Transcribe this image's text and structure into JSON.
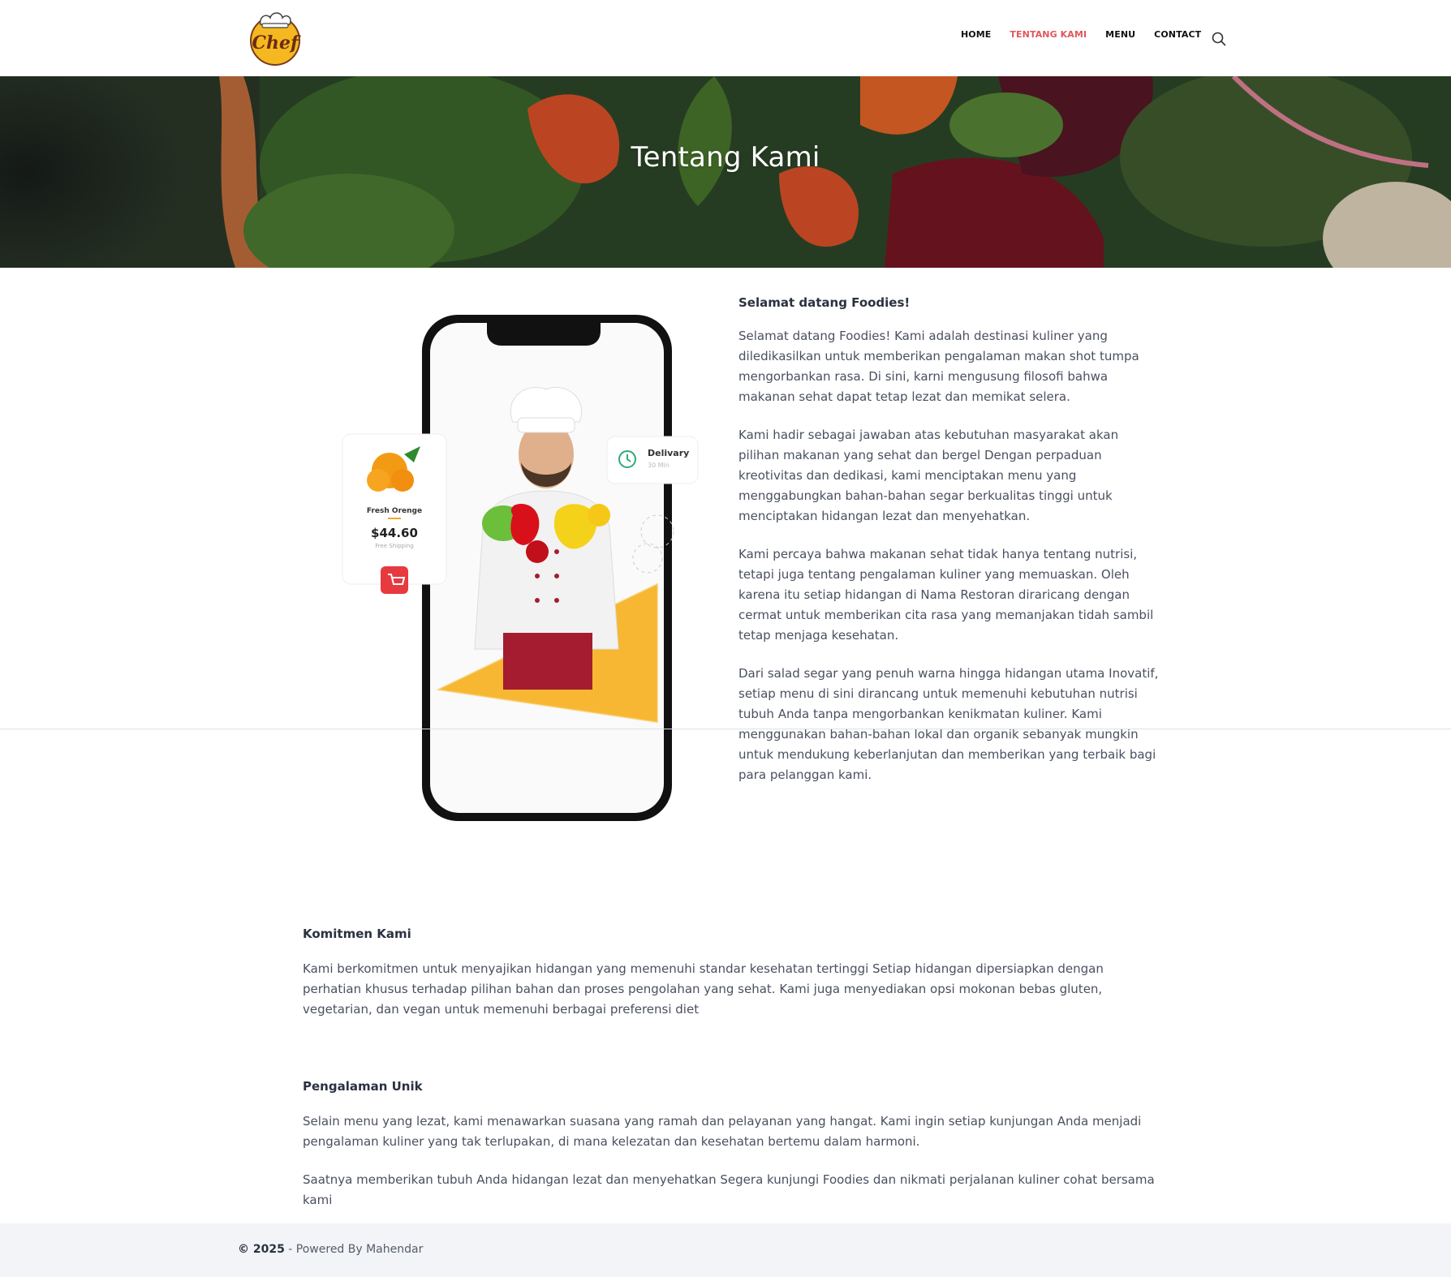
{
  "header": {
    "logo_text": "Chef",
    "nav": [
      {
        "label": "HOME",
        "active": false
      },
      {
        "label": "TENTANG KAMI",
        "active": true
      },
      {
        "label": "MENU",
        "active": false
      },
      {
        "label": "CONTACT",
        "active": false
      }
    ],
    "search_icon": "search-icon"
  },
  "hero": {
    "title": "Tentang Kami"
  },
  "illustration": {
    "product_name": "Fresh Orenge",
    "price": "$44.60",
    "shipping": "Free Shipping",
    "delivery_label": "Delivary",
    "delivery_time": "30 Min"
  },
  "about": {
    "heading": "Selamat datang Foodies!",
    "paragraphs": [
      "Selamat datang Foodies! Kami adalah destinasi kuliner yang diledikasilkan untuk memberikan pengalaman makan shot tumpa mengorbankan rasa. Di sini, karni mengusung filosofi bahwa makanan sehat dapat tetap lezat dan memikat selera.",
      "Kami hadir sebagai jawaban atas kebutuhan masyarakat akan pilihan makanan yang sehat dan bergel Dengan perpaduan kreotivitas dan dedikasi, kami menciptakan menu yang menggabungkan bahan-bahan segar berkualitas tinggi untuk menciptakan hidangan lezat dan menyehatkan.",
      "Kami percaya bahwa makanan sehat tidak hanya tentang nutrisi, tetapi juga tentang pengalaman kuliner yang memuaskan. Oleh karena itu setiap hidangan di Nama Restoran diraricang dengan cermat untuk memberikan cita rasa yang memanjakan tidah sambil tetap menjaga kesehatan.",
      "Dari salad segar yang penuh warna hingga hidangan utama Inovatif, setiap menu di sini dirancang untuk memenuhi kebutuhan nutrisi tubuh Anda tanpa mengorbankan kenikmatan kuliner. Kami menggunakan bahan-bahan lokal dan organik sebanyak mungkin untuk mendukung keberlanjutan dan memberikan yang terbaik bagi para pelanggan kami."
    ]
  },
  "commitment": {
    "heading": "Komitmen Kami",
    "paragraph": "Kami berkomitmen untuk menyajikan hidangan yang memenuhi standar kesehatan tertinggi Setiap hidangan dipersiapkan dengan perhatian khusus terhadap pilihan bahan dan proses pengolahan yang sehat. Kami juga menyediakan opsi mokonan bebas gluten, vegetarian, dan vegan untuk memenuhi berbagai preferensi diet"
  },
  "experience": {
    "heading": "Pengalaman Unik",
    "paragraphs": [
      "Selain menu yang lezat, kami menawarkan suasana yang ramah dan pelayanan yang hangat. Kami ingin setiap kunjungan Anda menjadi pengalaman kuliner yang tak terlupakan, di mana kelezatan dan kesehatan bertemu dalam harmoni.",
      "Saatnya memberikan tubuh Anda hidangan lezat dan menyehatkan Segera kunjungi Foodies dan nikmati perjalanan kuliner cohat bersama kami"
    ]
  },
  "footer": {
    "year": "© 2025",
    "text": " - Powered By Mahendar"
  },
  "colors": {
    "accent": "#e0575b",
    "footer_bg": "#f2f4f7",
    "logo_yellow": "#f5b820"
  }
}
